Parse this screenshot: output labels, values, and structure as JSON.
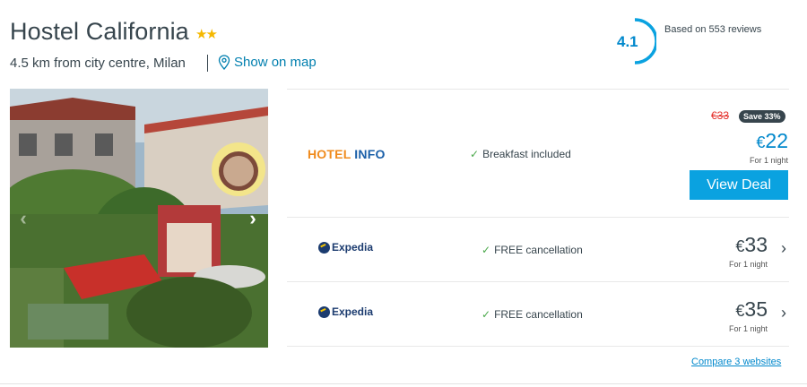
{
  "hotel": {
    "name": "Hostel California",
    "stars": "★★",
    "location": "4.5 km from city centre, Milan",
    "map_link": "Show on map",
    "rating": "4.1",
    "reviews": "Based on 553 reviews"
  },
  "deals": [
    {
      "provider": "HOTEL INFO",
      "provider_part1": "HOTEL",
      "provider_part2": "INFO",
      "feature": "Breakfast included",
      "old_price": "€33",
      "save_badge": "Save 33%",
      "currency": "€",
      "price": "22",
      "per_night": "For 1 night",
      "cta": "View Deal"
    },
    {
      "provider": "Expedia",
      "feature": "FREE cancellation",
      "currency": "€",
      "price": "33",
      "per_night": "For 1 night"
    },
    {
      "provider": "Expedia",
      "feature": "FREE cancellation",
      "currency": "€",
      "price": "35",
      "per_night": "For 1 night"
    }
  ],
  "compare_link": "Compare 3 websites",
  "icons": {
    "map": "map-pin-icon",
    "check": "checkmark-icon",
    "prev": "chevron-left-icon",
    "next": "chevron-right-icon"
  },
  "colors": {
    "accent": "#0088cc",
    "button": "#0aa2e0",
    "strike": "#e4302b",
    "stars": "#f5b800",
    "check": "#4aa84a"
  }
}
